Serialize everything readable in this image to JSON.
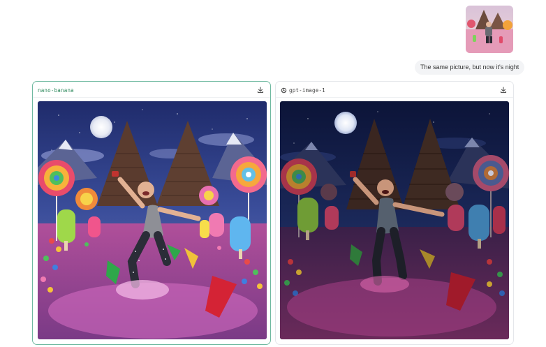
{
  "conversation": {
    "user_message": "The same picture, but now it's night"
  },
  "results": [
    {
      "model": "nano-banana",
      "icon": "none",
      "accent": "#2f8a5e"
    },
    {
      "model": "gpt-image-1",
      "icon": "openai-icon",
      "accent": "#444444"
    }
  ],
  "colors": {
    "selected_border": "#6fb9a0",
    "bubble": "#f3f4f6"
  }
}
